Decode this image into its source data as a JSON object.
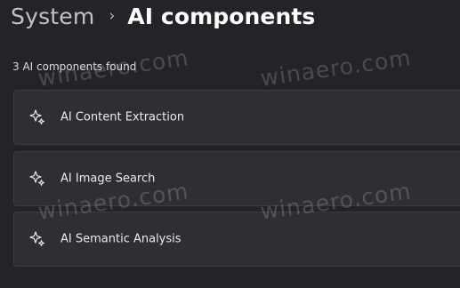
{
  "breadcrumb": {
    "parent": "System",
    "separator": "›",
    "current": "AI components"
  },
  "summary": {
    "count_text": "3 AI components found"
  },
  "components": [
    {
      "label": "AI Content Extraction",
      "icon": "sparkle-icon"
    },
    {
      "label": "AI Image Search",
      "icon": "sparkle-icon"
    },
    {
      "label": "AI Semantic Analysis",
      "icon": "sparkle-icon"
    }
  ],
  "watermark": {
    "text": "winaero.com"
  },
  "colors": {
    "background": "#222427",
    "card": "#2d2f33",
    "text": "#e9e9e9"
  }
}
